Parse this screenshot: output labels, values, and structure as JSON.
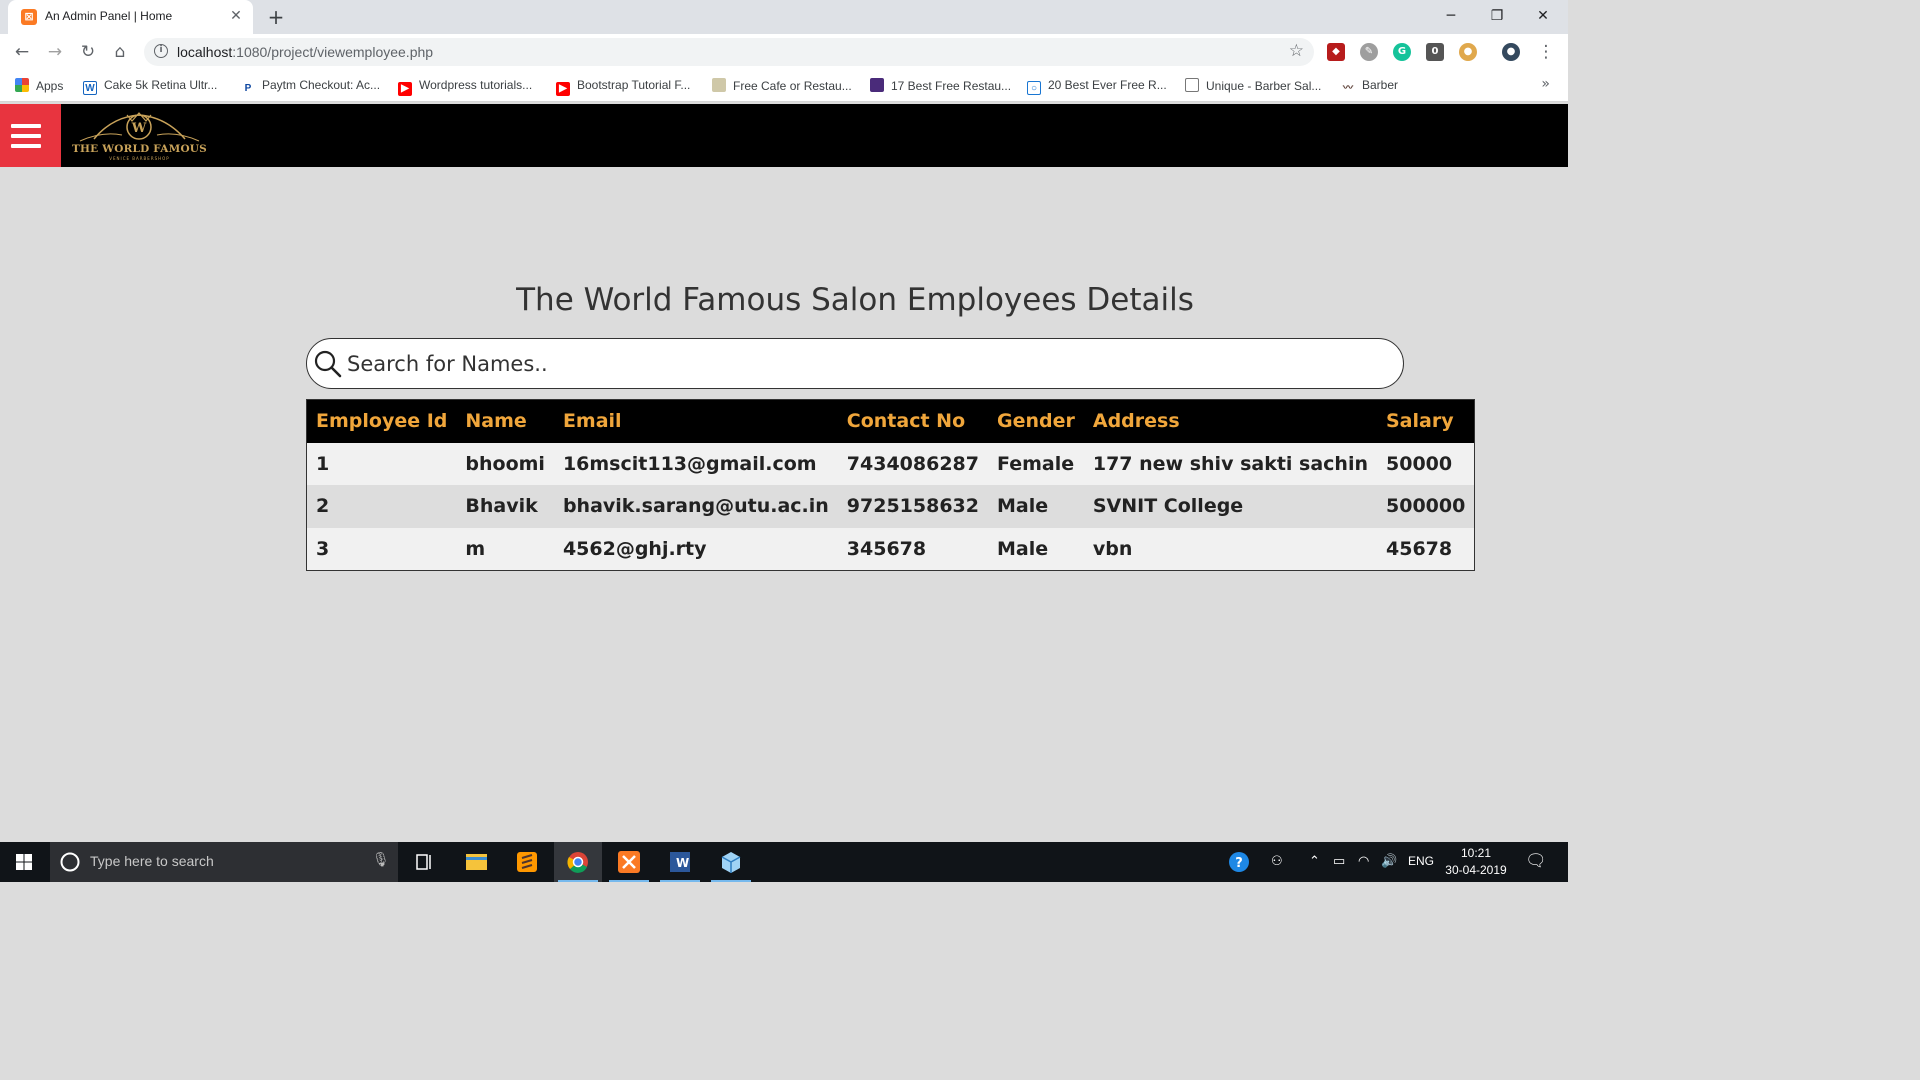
{
  "browser": {
    "tab_title": "An Admin Panel | Home",
    "url_host": "localhost",
    "url_path": ":1080/project/viewemployee.php",
    "bookmarks": [
      {
        "label": "Apps",
        "icon": "apps-grid-icon"
      },
      {
        "label": "Cake 5k Retina Ultr...",
        "icon": "cake-icon"
      },
      {
        "label": "Paytm Checkout: Ac...",
        "icon": "paytm-icon"
      },
      {
        "label": "Wordpress tutorials...",
        "icon": "youtube-icon"
      },
      {
        "label": "Bootstrap Tutorial F...",
        "icon": "youtube-icon"
      },
      {
        "label": "Free Cafe or Restau...",
        "icon": "page-thumb-icon"
      },
      {
        "label": "17 Best Free Restau...",
        "icon": "colorlib-icon"
      },
      {
        "label": "20 Best Ever Free R...",
        "icon": "bookmark-page-icon"
      },
      {
        "label": "Unique - Barber Sal...",
        "icon": "document-icon"
      },
      {
        "label": "Barber",
        "icon": "mustache-icon"
      }
    ]
  },
  "site": {
    "logo_text": "THE WORLD FAMOUS",
    "logo_sub": "VENICE BARBERSHOP",
    "logo_monogram": "W"
  },
  "page": {
    "title": "The World Famous Salon Employees Details",
    "search_placeholder": "Search for Names.."
  },
  "table": {
    "headers": [
      "Employee Id",
      "Name",
      "Email",
      "Contact No",
      "Gender",
      "Address",
      "Salary"
    ],
    "rows": [
      [
        "1",
        "bhoomi",
        "16mscit113@gmail.com",
        "7434086287",
        "Female",
        "177 new shiv sakti sachin",
        "50000"
      ],
      [
        "2",
        "Bhavik",
        "bhavik.sarang@utu.ac.in",
        "9725158632",
        "Male",
        "SVNIT College",
        "500000"
      ],
      [
        "3",
        "m",
        "4562@ghj.rty",
        "345678",
        "Male",
        "vbn",
        "45678"
      ]
    ]
  },
  "taskbar": {
    "search_placeholder": "Type here to search",
    "language": "ENG",
    "time": "10:21",
    "date": "30-04-2019"
  },
  "colors": {
    "header_bg": "#000000",
    "menu_button": "#e8343f",
    "table_header_text": "#f0a63b",
    "logo_gold": "#c9a35a"
  }
}
